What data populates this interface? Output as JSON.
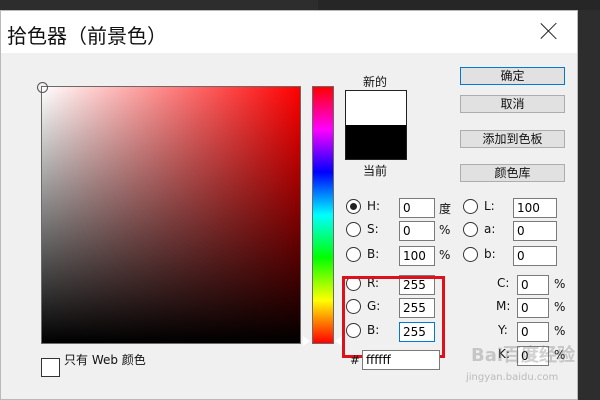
{
  "dialog": {
    "title": "拾色器（前景色）"
  },
  "swatch": {
    "new_label": "新的",
    "current_label": "当前"
  },
  "buttons": {
    "ok": "确定",
    "cancel": "取消",
    "add_to_swatches": "添加到色板",
    "color_libraries": "颜色库"
  },
  "hsb": {
    "h": {
      "label": "H:",
      "value": "0",
      "unit": "度"
    },
    "s": {
      "label": "S:",
      "value": "0",
      "unit": "%"
    },
    "b": {
      "label": "B:",
      "value": "100",
      "unit": "%"
    }
  },
  "lab": {
    "l": {
      "label": "L:",
      "value": "100"
    },
    "a": {
      "label": "a:",
      "value": "0"
    },
    "b": {
      "label": "b:",
      "value": "0"
    }
  },
  "rgb": {
    "r": {
      "label": "R:",
      "value": "255"
    },
    "g": {
      "label": "G:",
      "value": "255"
    },
    "b": {
      "label": "B:",
      "value": "255"
    }
  },
  "cmyk": {
    "c": {
      "label": "C:",
      "value": "0",
      "unit": "%"
    },
    "m": {
      "label": "M:",
      "value": "0",
      "unit": "%"
    },
    "y": {
      "label": "Y:",
      "value": "0",
      "unit": "%"
    },
    "k": {
      "label": "K:",
      "value": "0",
      "unit": "%"
    }
  },
  "hex": {
    "label": "#",
    "value": "ffffff"
  },
  "web_only": {
    "label": "只有 Web 颜色"
  },
  "watermark": {
    "main": "Bai百度经验",
    "sub": "jingyan.baidu.com"
  },
  "colors": {
    "highlight": "#e0101a",
    "primary_border": "#0078d7"
  }
}
